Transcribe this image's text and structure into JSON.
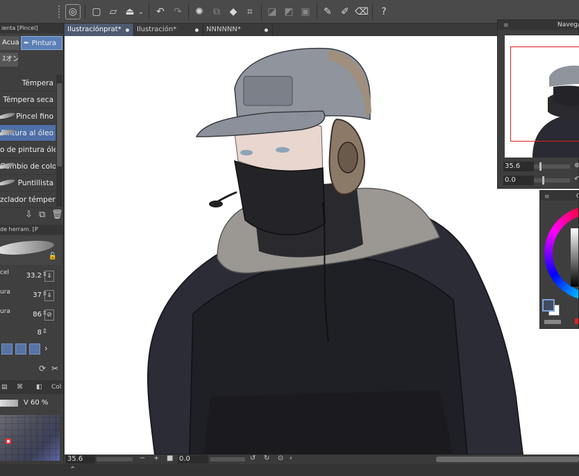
{
  "toolbar": {
    "icons": [
      "clip-studio-logo-icon",
      "new-file-icon",
      "open-folder-icon",
      "export-icon",
      "chevron-down-icon",
      "undo-icon",
      "redo-icon",
      "loading-spinner-icon",
      "select-transform-icon",
      "fill-icon",
      "crop-icon",
      "clear-outside-icon",
      "fill-inside-icon",
      "layer-mask-icon",
      "pen-icon",
      "brush-icon",
      "eraser-icon",
      "help-icon"
    ]
  },
  "left_panel": {
    "tab_label": "ienta [Pincel]",
    "buttons": {
      "acuarela": "Acuar",
      "pintura": "Pintura",
      "oil": "ｽオン"
    },
    "brushes": [
      {
        "label": "Témpera",
        "selected": false
      },
      {
        "label": "Témpera seca",
        "selected": false
      },
      {
        "label": "Pincel fino",
        "selected": false
      },
      {
        "label": "Pintura al óleo",
        "selected": true
      },
      {
        "label": "o de pintura óleo",
        "selected": false
      },
      {
        "label": "Cambio de color",
        "selected": false
      },
      {
        "label": "Puntillista",
        "selected": false
      },
      {
        "label": "zclador témpera",
        "selected": false
      }
    ],
    "subtab_label": "de herram. [P",
    "properties": [
      {
        "label": "cel",
        "value": "33.2"
      },
      {
        "label": "ura",
        "value": "37"
      },
      {
        "label": "ura",
        "value": "86"
      },
      {
        "label": "",
        "value": "8"
      }
    ],
    "color_section_label": "Col",
    "v_label": "V  60 %"
  },
  "doc_tabs": [
    {
      "label": "Ilustraciónprat*",
      "active": true
    },
    {
      "label": "Ilustración*",
      "active": false
    },
    {
      "label": "NNNNNN*",
      "active": false
    }
  ],
  "statusbar": {
    "zoom": "35.6",
    "rotation": "0.0"
  },
  "navigator": {
    "title": "Navega",
    "zoom": "35.6",
    "rotation": "0.0"
  },
  "color_panel": {
    "title": "C"
  },
  "colors": {
    "accent": "#5c7fb7",
    "panel_bg": "#3f3f3f",
    "toolbar_bg": "#4a4a4a",
    "frame_red": "#e02020"
  }
}
